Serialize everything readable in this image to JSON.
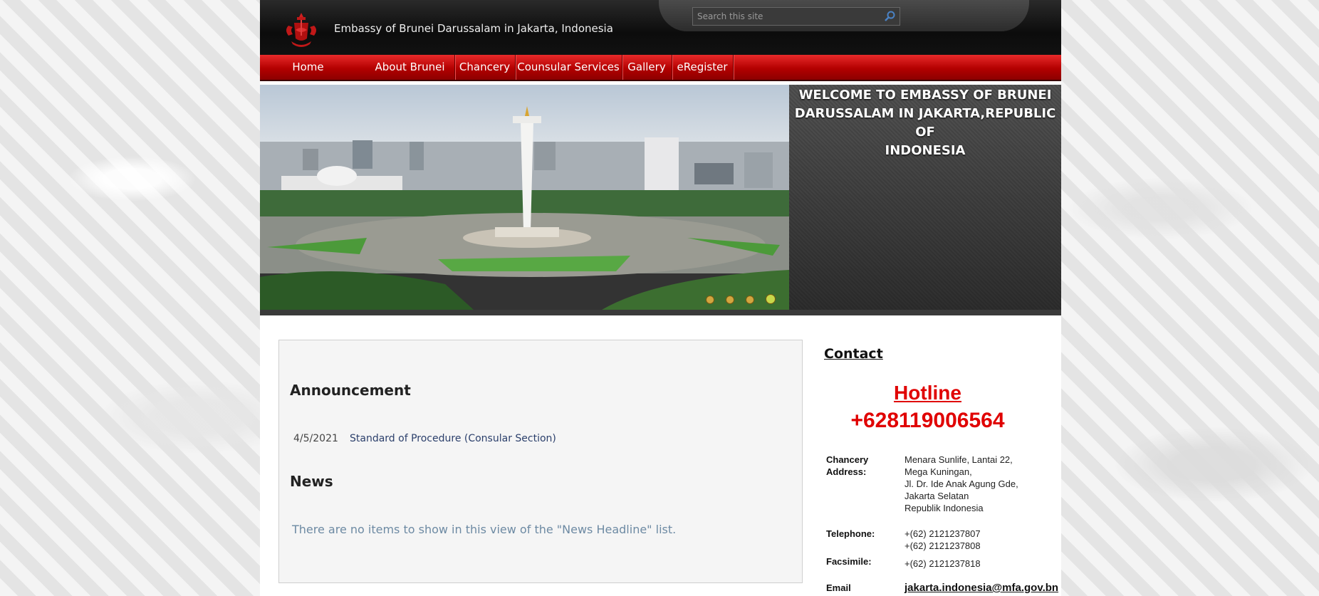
{
  "header": {
    "site_title": "Embassy of Brunei Darussalam in Jakarta, Indonesia",
    "search_placeholder": "Search this site"
  },
  "nav": {
    "items": [
      {
        "label": "Home"
      },
      {
        "label": "About Brunei"
      },
      {
        "label": "Chancery"
      },
      {
        "label": "Counsular Services"
      },
      {
        "label": "Gallery"
      },
      {
        "label": "eRegister"
      }
    ]
  },
  "banner": {
    "welcome_line1": "WELCOME TO EMBASSY OF BRUNEI",
    "welcome_line2": "DARUSSALAM IN JAKARTA,REPUBLIC OF",
    "welcome_line3": "INDONESIA",
    "slides_total": 4,
    "active_slide": 4
  },
  "main": {
    "announcement_heading": "Announcement",
    "announcements": [
      {
        "date": "4/5/2021",
        "title": "Standard of Procedure (Consular Section)"
      }
    ],
    "news_heading": "News",
    "news_empty": "There are no items to show in this view of the \"News Headline\" list."
  },
  "contact": {
    "heading": "Contact",
    "hotline_label": "Hotline",
    "hotline_number": "+628119006564",
    "address_label_1": "Chancery",
    "address_label_2": "Address:",
    "address_lines": [
      "Menara Sunlife, Lantai 22,",
      "Mega Kuningan,",
      "Jl. Dr. Ide Anak Agung Gde,",
      "Jakarta Selatan",
      "Republik Indonesia"
    ],
    "telephone_label": "Telephone:",
    "telephone_1": "+(62) 2121237807",
    "telephone_2": "+(62) 2121237808",
    "facsimile_label": "Facsimile:",
    "facsimile": "+(62) 2121237818",
    "email_label": "Email",
    "email": "jakarta.indonesia@mfa.gov.bn"
  },
  "colors": {
    "nav_red": "#cc0000",
    "hotline_red": "#e00000",
    "header_black": "#111111"
  }
}
